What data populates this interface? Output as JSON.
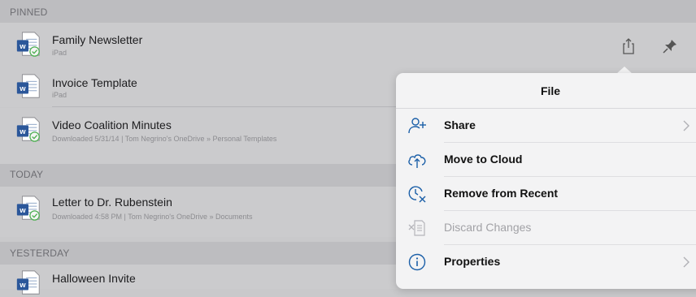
{
  "sections": {
    "pinned": "PINNED",
    "today": "TODAY",
    "yesterday": "YESTERDAY"
  },
  "documents": [
    {
      "title": "Family Newsletter",
      "subtitle": "iPad",
      "icon": "word-doc-synced-icon"
    },
    {
      "title": "Invoice Template",
      "subtitle": "iPad",
      "icon": "word-doc-icon"
    },
    {
      "title": "Video Coalition Minutes",
      "subtitle": "Downloaded 5/31/14 | Tom Negrino's OneDrive » Personal Templates",
      "icon": "word-doc-synced-icon"
    },
    {
      "title": "Letter to Dr. Rubenstein",
      "subtitle": "Downloaded 4:58 PM | Tom Negrino's OneDrive » Documents",
      "icon": "word-doc-synced-icon"
    },
    {
      "title": "Halloween Invite",
      "subtitle": "",
      "icon": "word-doc-icon"
    }
  ],
  "row_actions": [
    "share-icon",
    "pin-icon"
  ],
  "popover": {
    "title": "File",
    "items": [
      {
        "label": "Share",
        "icon": "add-person-icon",
        "has_chevron": true,
        "enabled": true
      },
      {
        "label": "Move to Cloud",
        "icon": "cloud-upload-icon",
        "has_chevron": false,
        "enabled": true
      },
      {
        "label": "Remove from Recent",
        "icon": "clock-remove-icon",
        "has_chevron": false,
        "enabled": true
      },
      {
        "label": "Discard Changes",
        "icon": "discard-doc-icon",
        "has_chevron": false,
        "enabled": false
      },
      {
        "label": "Properties",
        "icon": "info-icon",
        "has_chevron": true,
        "enabled": true
      }
    ]
  },
  "colors": {
    "word_blue": "#2b579a",
    "sync_green": "#4caf50",
    "accent_blue": "#1b5fa8"
  }
}
